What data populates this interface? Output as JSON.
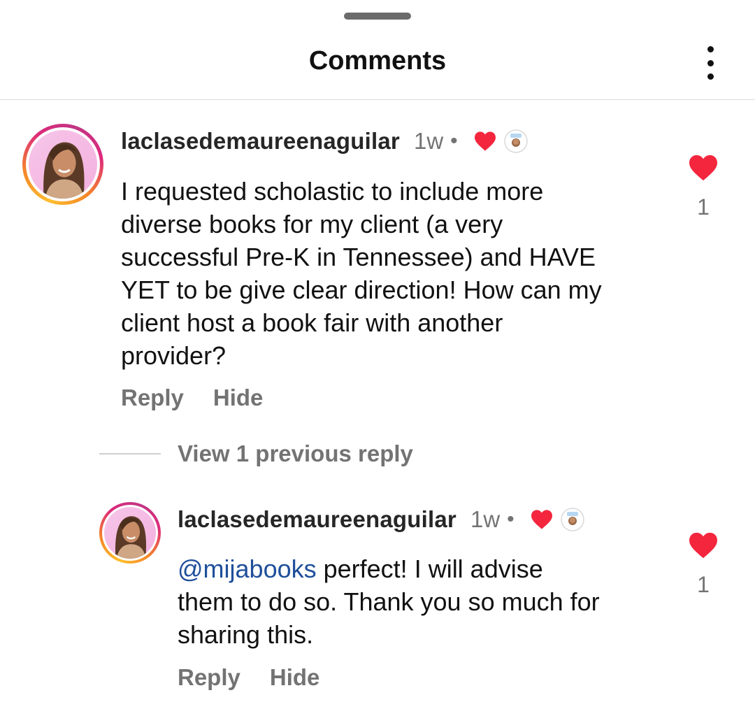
{
  "header": {
    "title": "Comments"
  },
  "colors": {
    "heart": "#f3263e",
    "mention": "#1f4f9a",
    "muted": "#737373"
  },
  "comments": [
    {
      "username": "laclasedemaureenaguilar",
      "time": "1w",
      "separator": "•",
      "text_lines": [
        "I requested scholastic to include more",
        "diverse books for my client (a very",
        "successful Pre-K in Tennessee) and HAVE",
        "YET to be give clear direction! How can my",
        "client host a book fair with another",
        "provider?"
      ],
      "like_count": "1",
      "actions": {
        "reply": "Reply",
        "hide": "Hide"
      }
    }
  ],
  "view_replies": "View 1 previous reply",
  "reply": {
    "username": "laclasedemaureenaguilar",
    "time": "1w",
    "separator": "•",
    "mention": "@mijabooks",
    "text_lines": [
      " perfect! I will advise",
      "them to do so. Thank you so much for",
      "sharing this."
    ],
    "like_count": "1",
    "actions": {
      "reply": "Reply",
      "hide": "Hide"
    }
  }
}
